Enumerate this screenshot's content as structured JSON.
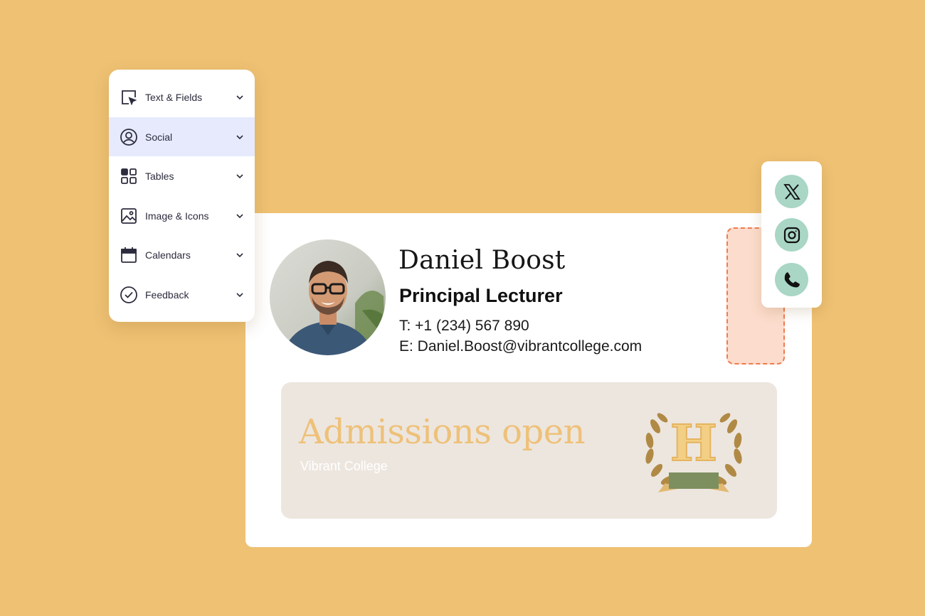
{
  "colors": {
    "background": "#eec173",
    "card": "#ffffff",
    "menu_active": "#e6eafc",
    "social_button": "#a9d6c5",
    "banner_background": "#ede6df",
    "banner_headline": "#eec179",
    "crest_gold": "#b08a45",
    "crest_ribbon": "#7d8f5e",
    "placeholder_fill": "#fcdccc",
    "placeholder_border": "#ee7b4f"
  },
  "menu": {
    "items": [
      {
        "label": "Text & Fields",
        "icon": "cursor-select-icon",
        "active": false
      },
      {
        "label": "Social",
        "icon": "user-circle-icon",
        "active": true
      },
      {
        "label": "Tables",
        "icon": "grid-icon",
        "active": false
      },
      {
        "label": "Image & Icons",
        "icon": "image-icon",
        "active": false
      },
      {
        "label": "Calendars",
        "icon": "calendar-icon",
        "active": false
      },
      {
        "label": "Feedback",
        "icon": "check-circle-icon",
        "active": false
      }
    ]
  },
  "signature": {
    "name": "Daniel Boost",
    "title": "Principal Lecturer",
    "phone": "T: +1 (234) 567 890",
    "email": "E: Daniel.Boost@vibrantcollege.com"
  },
  "banner": {
    "headline": "Admissions open",
    "subtitle": "Vibrant College",
    "crest_letter": "H"
  },
  "social": {
    "icons": [
      "x-logo-icon",
      "instagram-icon",
      "phone-icon"
    ]
  }
}
